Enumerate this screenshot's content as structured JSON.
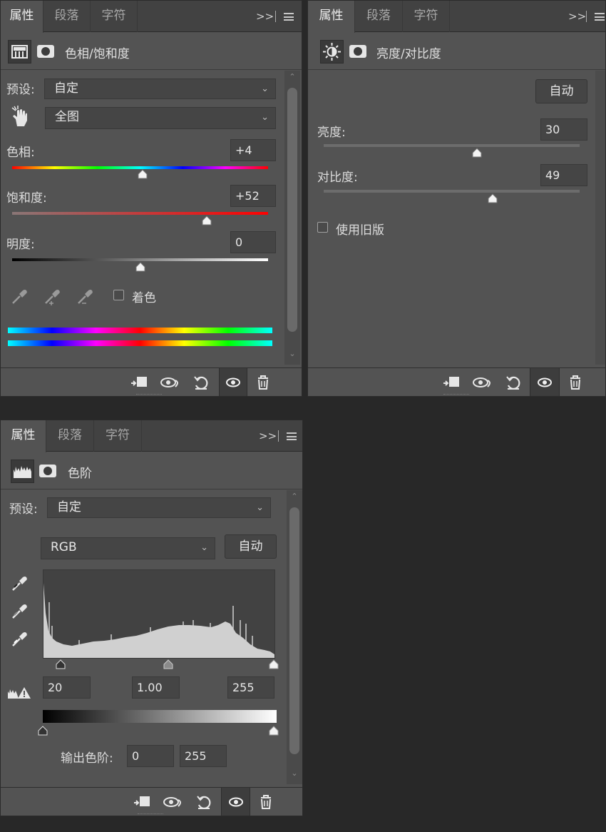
{
  "tabs": {
    "properties": "属性",
    "paragraph": "段落",
    "character": "字符",
    "more": ">>"
  },
  "hue_saturation": {
    "title": "色相/饱和度",
    "preset_label": "预设:",
    "preset_value": "自定",
    "channel_value": "全图",
    "hue_label": "色相:",
    "hue_value": "+4",
    "saturation_label": "饱和度:",
    "saturation_value": "+52",
    "lightness_label": "明度:",
    "lightness_value": "0",
    "colorize_label": "着色",
    "sliders": {
      "hue": 4,
      "hue_range": [
        -180,
        180
      ],
      "saturation": 52,
      "saturation_range": [
        -100,
        100
      ],
      "lightness": 0,
      "lightness_range": [
        -100,
        100
      ]
    }
  },
  "brightness_contrast": {
    "title": "亮度/对比度",
    "auto_label": "自动",
    "brightness_label": "亮度:",
    "brightness_value": "30",
    "contrast_label": "对比度:",
    "contrast_value": "49",
    "legacy_label": "使用旧版",
    "sliders": {
      "brightness": 30,
      "brightness_range": [
        -150,
        150
      ],
      "contrast": 49,
      "contrast_range": [
        -50,
        100
      ]
    }
  },
  "levels": {
    "title": "色阶",
    "preset_label": "预设:",
    "preset_value": "自定",
    "channel_value": "RGB",
    "auto_label": "自动",
    "input_black": "20",
    "input_gamma": "1.00",
    "input_white": "255",
    "output_label": "输出色阶:",
    "output_black": "0",
    "output_white": "255"
  },
  "colors": {
    "panel_bg": "#535353",
    "tab_bar_bg": "#424242",
    "field_bg": "#454545",
    "workspace_bg": "#282828",
    "text": "#dcdcdc"
  },
  "icons": {
    "footer": [
      "clip-to-layer-icon",
      "view-previous-state-icon",
      "reset-icon",
      "visibility-eye-icon",
      "trash-icon"
    ],
    "eyedroppers": [
      "eyedropper-icon",
      "eyedropper-add-icon",
      "eyedropper-subtract-icon"
    ],
    "levels_eyedroppers": [
      "eyedropper-black-icon",
      "eyedropper-gray-icon",
      "eyedropper-white-icon"
    ]
  }
}
